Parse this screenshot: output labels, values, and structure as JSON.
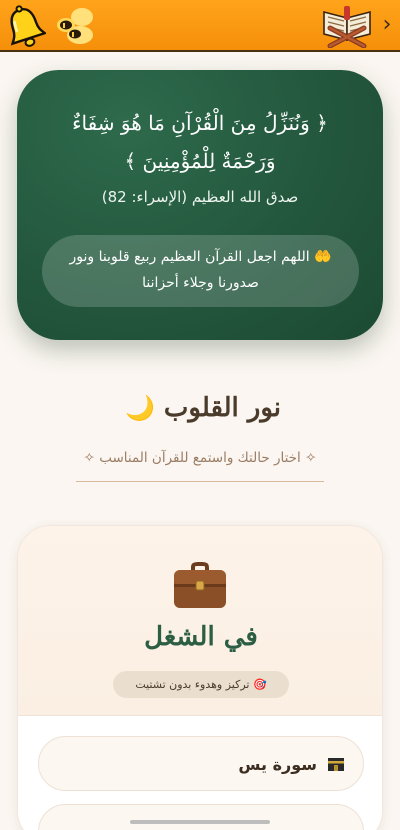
{
  "topbar": {
    "bell_icon": "bell-icon",
    "bees_icon": "bees-icon",
    "quran_icon": "quran-stand-icon",
    "back_icon": "chevron-right-icon",
    "back_label": "›"
  },
  "verse_card": {
    "verse": "﴿ وَنُنَزِّلُ مِنَ الْقُرْآنِ مَا هُوَ شِفَاءٌ وَرَحْمَةٌ لِلْمُؤْمِنِينَ ﴾",
    "reference": "صدق الله العظيم (الإسراء: 82)",
    "dua_icon": "🤲",
    "dua": "اللهم اجعل القرآن العظيم ربيع قلوبنا ونور صدورنا وجلاء أحزاننا"
  },
  "header": {
    "moon": "🌙",
    "title": "نور القلوب",
    "subtitle": "✧ اختار حالتك واستمع للقرآن المناسب ✧"
  },
  "mood": {
    "icon": "briefcase-icon",
    "title": "في الشغل",
    "badge_icon": "🎯",
    "badge": "تركيز وهدوء بدون تشتيت",
    "surahs": [
      {
        "label": "سورة يس",
        "icon": "kaaba-icon"
      },
      {
        "label": "",
        "icon": ""
      }
    ]
  },
  "colors": {
    "topbar": "#f5960f",
    "card_green": "#23573d",
    "title_green": "#2c5e43",
    "background": "#fbf6f1"
  }
}
